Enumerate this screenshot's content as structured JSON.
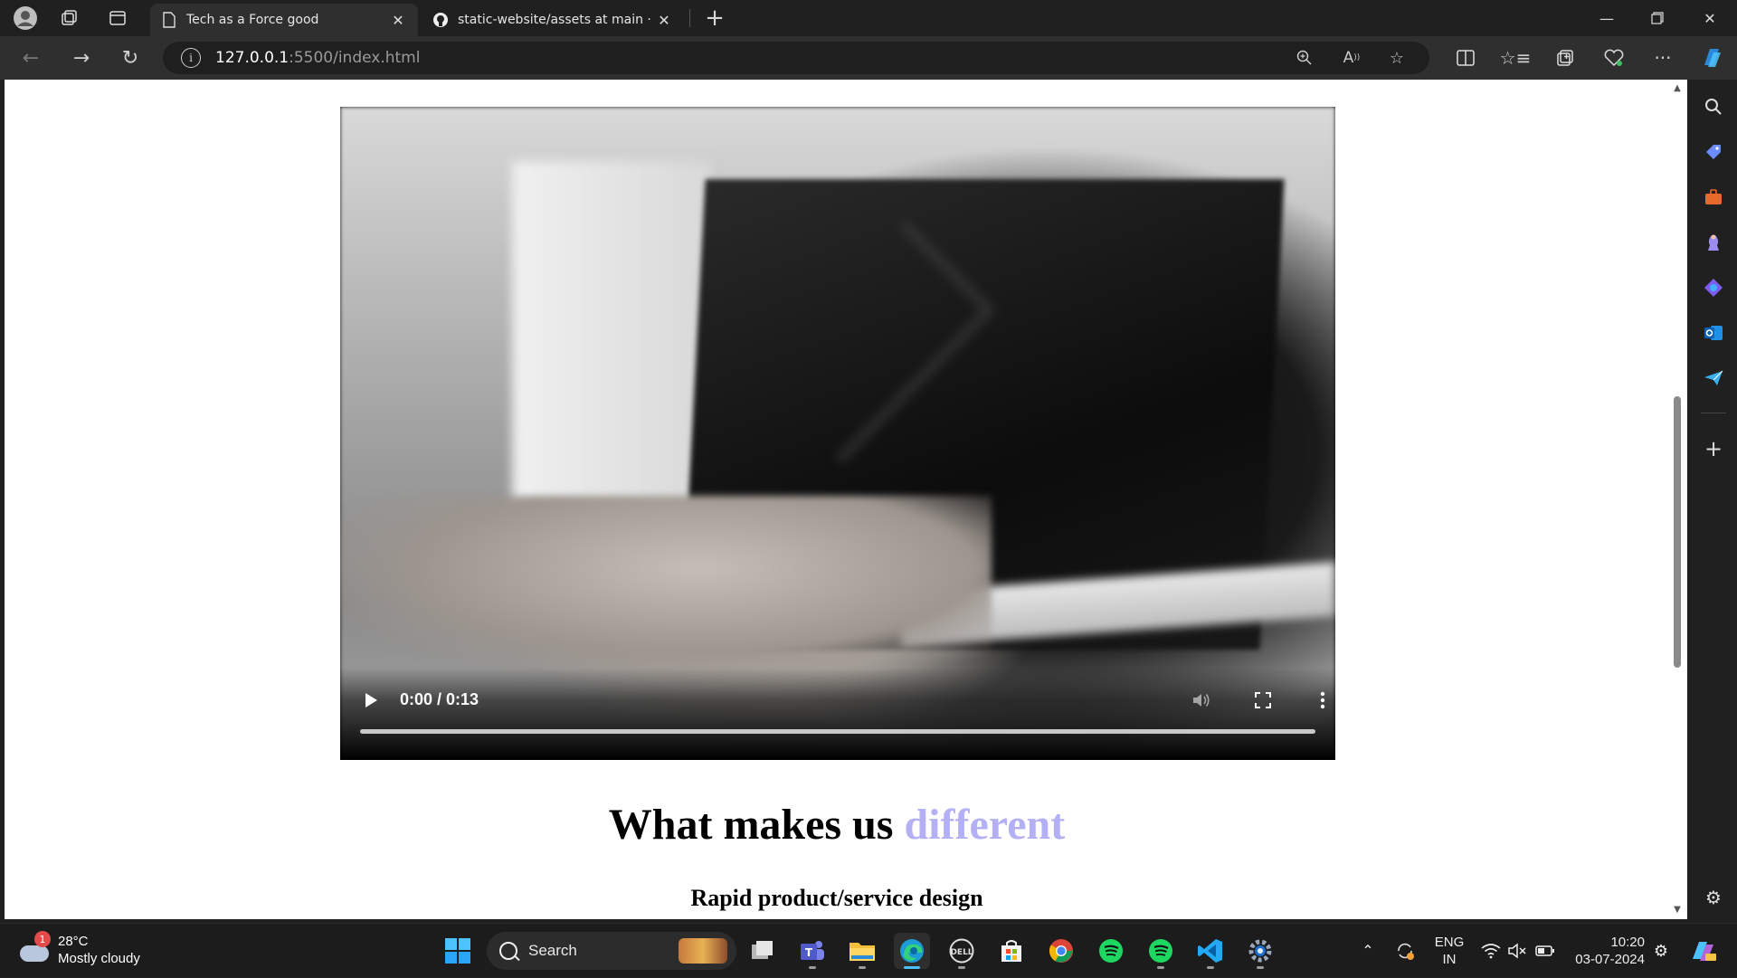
{
  "browser": {
    "tabs": [
      {
        "title": "Tech as a Force good",
        "active": true
      },
      {
        "title": "static-website/assets at main · Se",
        "active": false
      }
    ],
    "new_tab_label": "+",
    "url_host": "127.0.0.1",
    "url_rest": ":5500/index.html",
    "window_controls": [
      "minimize",
      "restore",
      "close"
    ]
  },
  "page": {
    "video": {
      "time": "0:00 / 0:13",
      "progress_fraction": 0.0
    },
    "heading_main": "What makes us ",
    "heading_accent": "different",
    "subheading": "Rapid product/service design",
    "accent_color": "#b3b0f5"
  },
  "sidebar": {
    "items": [
      "search-icon",
      "tag-icon",
      "toolbox-icon",
      "chess-icon",
      "copilot-icon",
      "outlook-icon",
      "send-icon",
      "add-icon",
      "settings-icon"
    ]
  },
  "taskbar": {
    "weather": {
      "badge": "1",
      "temperature": "28°C",
      "condition": "Mostly cloudy"
    },
    "search_label": "Search",
    "apps": [
      "start",
      "task-view",
      "teams",
      "file-explorer",
      "edge",
      "dell",
      "store",
      "chrome",
      "spotify",
      "spotify-2",
      "vscode",
      "settings"
    ],
    "tray": {
      "language_line1": "ENG",
      "language_line2": "IN",
      "time": "10:20",
      "date": "03-07-2024"
    }
  }
}
